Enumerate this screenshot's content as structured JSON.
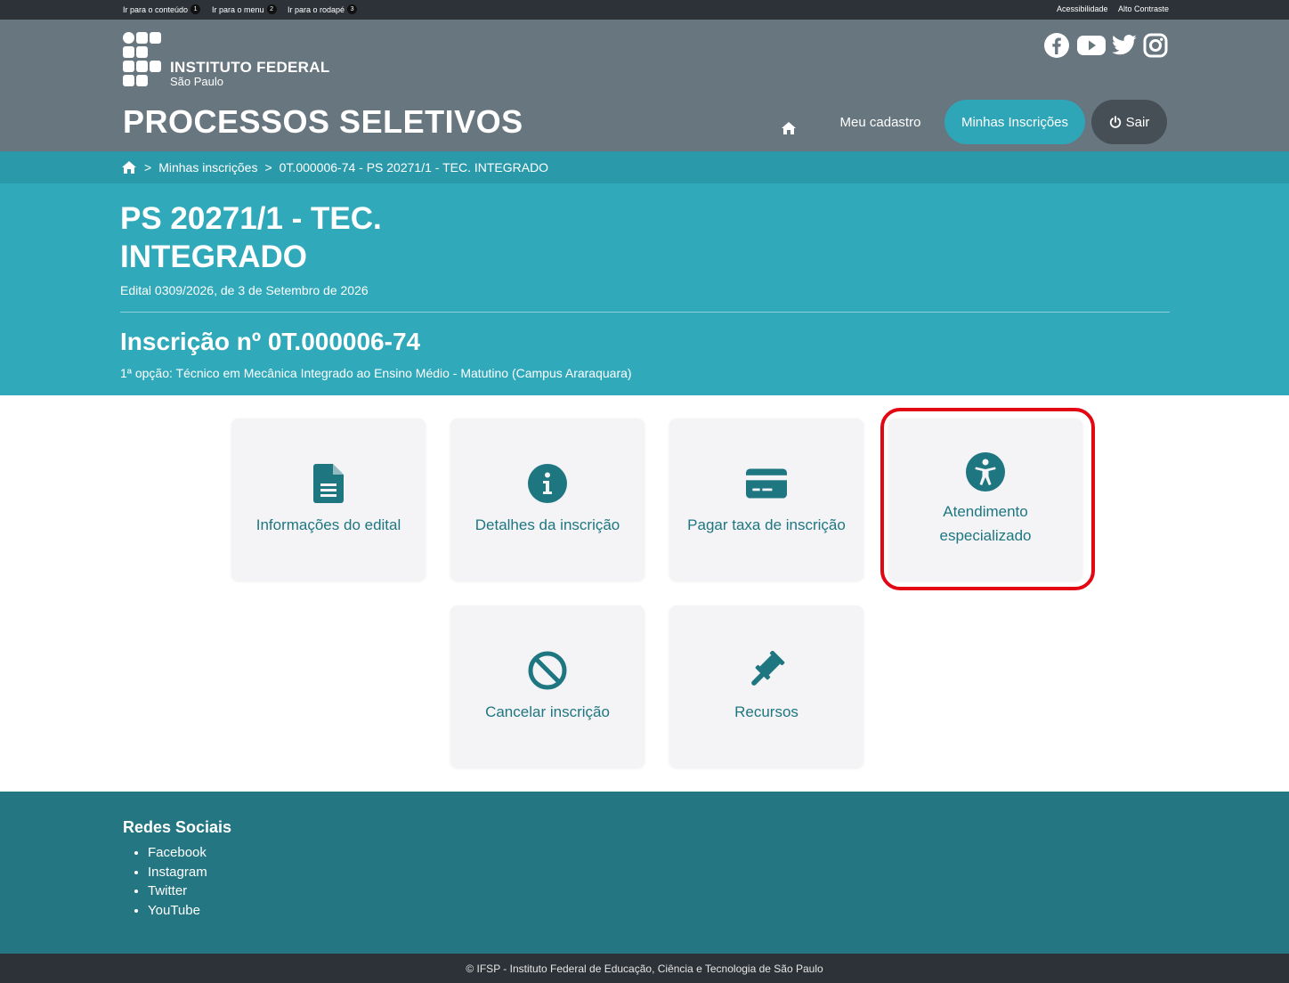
{
  "topbar": {
    "skip_content": "Ir para o conteúdo",
    "skip_content_key": "1",
    "skip_menu": "Ir para o menu",
    "skip_menu_key": "2",
    "skip_footer": "Ir para o rodapé",
    "skip_footer_key": "3",
    "accessibility": "Acessibilidade",
    "high_contrast": "Alto Contraste"
  },
  "header": {
    "logo_line1": "INSTITUTO FEDERAL",
    "logo_line2": "São Paulo",
    "site_title": "PROCESSOS SELETIVOS",
    "social_icons": [
      "facebook-icon",
      "youtube-icon",
      "twitter-icon",
      "instagram-icon"
    ]
  },
  "nav": {
    "home_icon": "home-icon",
    "meu_cadastro": "Meu cadastro",
    "minhas_inscricoes": "Minhas Inscrições",
    "sair": "Sair"
  },
  "breadcrumb": {
    "home_icon": "home-icon",
    "sep": ">",
    "item1": "Minhas inscrições",
    "item2": "0T.000006-74 - PS 20271/1 - TEC. INTEGRADO"
  },
  "hero": {
    "title": "PS 20271/1 - TEC. INTEGRADO",
    "edital": "Edital 0309/2026, de 3 de Setembro de 2026",
    "inscricao": "Inscrição nº 0T.000006-74",
    "opcao": "1ª opção: Técnico em Mecânica Integrado ao Ensino Médio - Matutino (Campus Araraquara)"
  },
  "cards": [
    {
      "label": "Informações do edital",
      "icon": "document-icon"
    },
    {
      "label": "Detalhes da inscrição",
      "icon": "info-icon"
    },
    {
      "label": "Pagar taxa de inscrição",
      "icon": "credit-card-icon"
    },
    {
      "label": "Atendimento especializado",
      "icon": "accessibility-icon"
    },
    {
      "label": "Cancelar inscrição",
      "icon": "ban-icon"
    },
    {
      "label": "Recursos",
      "icon": "gavel-icon"
    }
  ],
  "footer": {
    "title": "Redes Sociais",
    "links": [
      "Facebook",
      "Instagram",
      "Twitter",
      "YouTube"
    ],
    "copyright": "© IFSP - Instituto Federal de Educação, Ciência e Tecnologia de São Paulo"
  },
  "colors": {
    "header_bg": "#67767f",
    "accent": "#30a9ba",
    "card_text": "#1e7681",
    "footer_bg": "#237682",
    "highlight": "#e30613"
  }
}
